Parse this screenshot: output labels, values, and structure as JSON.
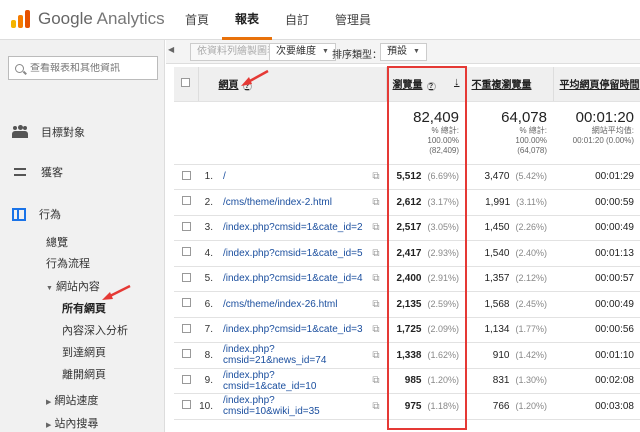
{
  "app": {
    "logo_google": "Google",
    "logo_analytics": "Analytics"
  },
  "topnav": [
    "首頁",
    "報表",
    "自訂",
    "管理員"
  ],
  "sidebar": {
    "search_placeholder": "查看報表和其他資訊",
    "sections": [
      {
        "label": "目標對象",
        "icon": "people-icon"
      },
      {
        "label": "獲客",
        "icon": "acquisition-icon"
      },
      {
        "label": "行為",
        "icon": "behavior-icon"
      }
    ],
    "behavior_items": [
      "總覽",
      "行為流程"
    ],
    "site_content": "網站內容",
    "site_content_items": [
      "所有網頁",
      "內容深入分析",
      "到達網頁",
      "離開網頁"
    ],
    "more_items": [
      "網站速度",
      "站內搜尋"
    ]
  },
  "toolbar": {
    "plot_rows": "依資料列繪製圖表",
    "secondary_dimension": "次要維度",
    "sort_type_label": "排序類型：",
    "sort_type_value": "預設"
  },
  "table": {
    "headers": {
      "page": "網頁",
      "pageviews": "瀏覽量",
      "unique": "不重複瀏覽量",
      "avg_time": "平均網頁停留時間"
    },
    "totals": {
      "pageviews": "82,409",
      "pageviews_note1": "% 總計:",
      "pageviews_note2": "100.00%",
      "pageviews_note3": "(82,409)",
      "unique": "64,078",
      "unique_note1": "% 總計:",
      "unique_note2": "100.00%",
      "unique_note3": "(64,078)",
      "avg_time": "00:01:20",
      "avg_time_note1": "網站平均值:",
      "avg_time_note2": "00:01:20 (0.00%)"
    },
    "rows": [
      {
        "idx": "1.",
        "page": "/",
        "pv": "5,512",
        "pv_pct": "(6.69%)",
        "uv": "3,470",
        "uv_pct": "(5.42%)",
        "time": "00:01:29"
      },
      {
        "idx": "2.",
        "page": "/cms/theme/index-2.html",
        "pv": "2,612",
        "pv_pct": "(3.17%)",
        "uv": "1,991",
        "uv_pct": "(3.11%)",
        "time": "00:00:59"
      },
      {
        "idx": "3.",
        "page": "/index.php?cmsid=1&cate_id=2",
        "pv": "2,517",
        "pv_pct": "(3.05%)",
        "uv": "1,450",
        "uv_pct": "(2.26%)",
        "time": "00:00:49"
      },
      {
        "idx": "4.",
        "page": "/index.php?cmsid=1&cate_id=5",
        "pv": "2,417",
        "pv_pct": "(2.93%)",
        "uv": "1,540",
        "uv_pct": "(2.40%)",
        "time": "00:01:13"
      },
      {
        "idx": "5.",
        "page": "/index.php?cmsid=1&cate_id=4",
        "pv": "2,400",
        "pv_pct": "(2.91%)",
        "uv": "1,357",
        "uv_pct": "(2.12%)",
        "time": "00:00:57"
      },
      {
        "idx": "6.",
        "page": "/cms/theme/index-26.html",
        "pv": "2,135",
        "pv_pct": "(2.59%)",
        "uv": "1,568",
        "uv_pct": "(2.45%)",
        "time": "00:00:49"
      },
      {
        "idx": "7.",
        "page": "/index.php?cmsid=1&cate_id=3",
        "pv": "1,725",
        "pv_pct": "(2.09%)",
        "uv": "1,134",
        "uv_pct": "(1.77%)",
        "time": "00:00:56"
      },
      {
        "idx": "8.",
        "page": "/index.php?cmsid=21&news_id=74",
        "pv": "1,338",
        "pv_pct": "(1.62%)",
        "uv": "910",
        "uv_pct": "(1.42%)",
        "time": "00:01:10"
      },
      {
        "idx": "9.",
        "page": "/index.php?cmsid=1&cate_id=10",
        "pv": "985",
        "pv_pct": "(1.20%)",
        "uv": "831",
        "uv_pct": "(1.30%)",
        "time": "00:02:08"
      },
      {
        "idx": "10.",
        "page": "/index.php?cmsid=10&wiki_id=35",
        "pv": "975",
        "pv_pct": "(1.18%)",
        "uv": "766",
        "uv_pct": "(1.20%)",
        "time": "00:03:08"
      }
    ]
  },
  "colors": {
    "accent": "#e8710a",
    "highlight": "#e53935",
    "link": "#1a4e9e"
  }
}
